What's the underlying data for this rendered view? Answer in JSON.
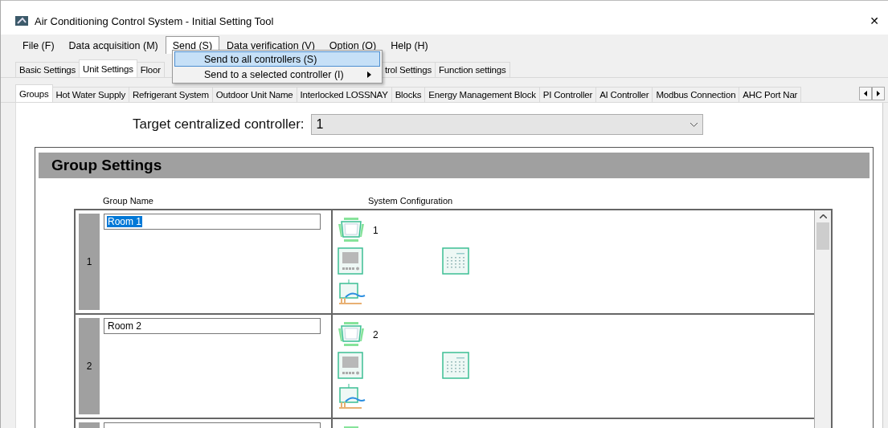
{
  "window": {
    "title": "Air Conditioning Control System - Initial Setting Tool",
    "close": "✕"
  },
  "menu_bar": [
    {
      "label": "File (F)",
      "open": false
    },
    {
      "label": "Data acquisition (M)",
      "open": false
    },
    {
      "label": "Send (S)",
      "open": true
    },
    {
      "label": "Data verification (V)",
      "open": false
    },
    {
      "label": "Option (O)",
      "open": false
    },
    {
      "label": "Help (H)",
      "open": false
    }
  ],
  "send_menu": [
    {
      "label": "Send to all controllers (S)",
      "selected": true,
      "submenu": false
    },
    {
      "label": "Send to a selected controller (I)",
      "selected": false,
      "submenu": true
    }
  ],
  "main_tabs": [
    {
      "label": "Basic Settings",
      "selected": false
    },
    {
      "label": "Unit Settings",
      "selected": true
    },
    {
      "label": "Floor",
      "selected": false
    },
    {
      "label": "trol Settings",
      "selected": false
    },
    {
      "label": "Function settings",
      "selected": false
    }
  ],
  "sub_tabs": [
    {
      "label": "Groups",
      "selected": true
    },
    {
      "label": "Hot Water Supply",
      "selected": false
    },
    {
      "label": "Refrigerant System",
      "selected": false
    },
    {
      "label": "Outdoor Unit Name",
      "selected": false
    },
    {
      "label": "Interlocked LOSSNAY",
      "selected": false
    },
    {
      "label": "Blocks",
      "selected": false
    },
    {
      "label": "Energy Management Block",
      "selected": false
    },
    {
      "label": "PI Controller",
      "selected": false
    },
    {
      "label": "AI Controller",
      "selected": false
    },
    {
      "label": "Modbus Connection",
      "selected": false
    },
    {
      "label": "AHC Port Nar",
      "selected": false
    }
  ],
  "target_controller": {
    "label": "Target centralized controller:",
    "value": "1"
  },
  "group_settings": {
    "title": "Group Settings",
    "columns": [
      "Group Name",
      "System Configuration"
    ],
    "rows": [
      {
        "number": "1",
        "name": "Room 1",
        "name_highlighted": true,
        "unit": "1"
      },
      {
        "number": "2",
        "name": "Room 2",
        "name_highlighted": false,
        "unit": "2"
      },
      {}
    ]
  }
}
